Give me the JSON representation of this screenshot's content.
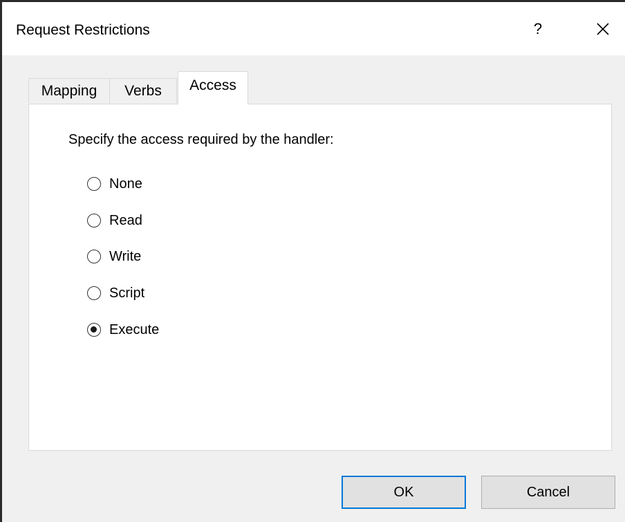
{
  "dialog": {
    "title": "Request Restrictions",
    "help_label": "?",
    "close_icon": "close-icon"
  },
  "tabs": [
    {
      "label": "Mapping",
      "active": false
    },
    {
      "label": "Verbs",
      "active": false
    },
    {
      "label": "Access",
      "active": true
    }
  ],
  "access": {
    "prompt": "Specify the access required by the handler:",
    "options": [
      {
        "label": "None",
        "checked": false
      },
      {
        "label": "Read",
        "checked": false
      },
      {
        "label": "Write",
        "checked": false
      },
      {
        "label": "Script",
        "checked": false
      },
      {
        "label": "Execute",
        "checked": true
      }
    ]
  },
  "buttons": {
    "ok_label": "OK",
    "cancel_label": "Cancel"
  },
  "colors": {
    "accent": "#0078d7",
    "window_bg": "#f0f0f0",
    "panel_bg": "#ffffff"
  }
}
